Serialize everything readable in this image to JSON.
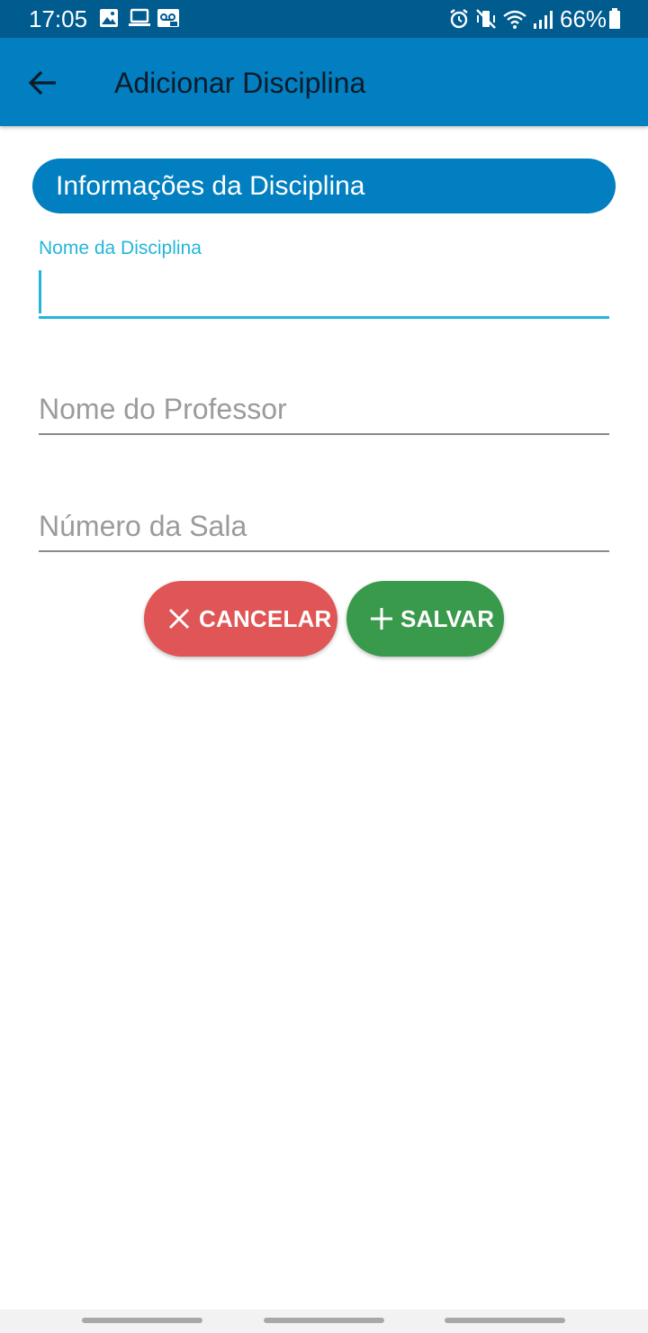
{
  "status_bar": {
    "time": "17:05",
    "battery": "66%",
    "left_icons": [
      "image-icon",
      "laptop-icon",
      "voicemail-icon"
    ],
    "right_icons": [
      "alarm-icon",
      "vibrate-mute-icon",
      "wifi-icon",
      "signal-icon",
      "battery-icon"
    ]
  },
  "app_bar": {
    "title": "Adicionar Disciplina",
    "back_icon": "arrow-left-icon"
  },
  "section": {
    "title": "Informações da Disciplina"
  },
  "form": {
    "subject_name": {
      "label": "Nome da Disciplina",
      "value": ""
    },
    "professor_name": {
      "placeholder": "Nome do Professor"
    },
    "room_number": {
      "placeholder": "Número da Sala"
    }
  },
  "buttons": {
    "cancel": {
      "label": "CANCELAR",
      "icon": "close-icon",
      "color": "#e05555"
    },
    "save": {
      "label": "SALVAR",
      "icon": "plus-icon",
      "color": "#3a9a4b"
    }
  },
  "colors": {
    "status_bar": "#005b8f",
    "primary": "#017fc0",
    "accent": "#24b5db",
    "title_text": "#0d1b2a"
  }
}
